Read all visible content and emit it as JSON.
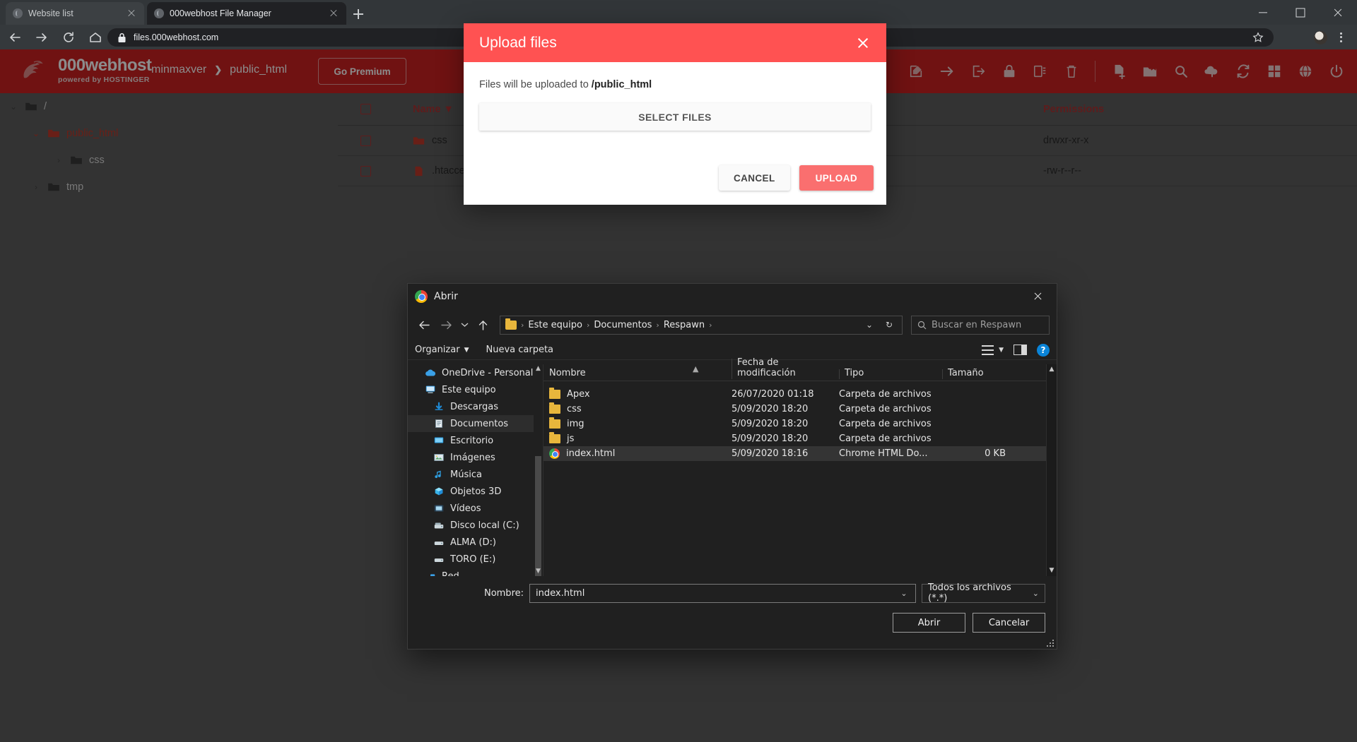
{
  "browser": {
    "tabs": [
      {
        "title": "Website list",
        "active": false
      },
      {
        "title": "000webhost File Manager",
        "active": true
      }
    ],
    "new_tab_label": "+",
    "url": "files.000webhost.com",
    "window_controls": {
      "minimize": "minimize-icon",
      "maximize": "maximize-icon",
      "close": "close-icon"
    }
  },
  "site": {
    "logo_name": "000webhost",
    "logo_sub": "powered by HOSTINGER",
    "breadcrumb": {
      "account": "minmaxver",
      "separator": "❯",
      "folder": "public_html"
    },
    "go_premium": "Go Premium",
    "toolbar_icons": [
      "edit-icon",
      "move-icon",
      "extract-icon",
      "permissions-icon",
      "copy-icon",
      "delete-icon",
      "new-file-icon",
      "new-folder-icon",
      "search-icon",
      "upload-icon",
      "refresh-icon",
      "apps-icon",
      "globe-icon",
      "power-icon"
    ]
  },
  "tree": [
    {
      "label": "/",
      "caret": "⌄",
      "indent": 0,
      "highlight": false
    },
    {
      "label": "public_html",
      "caret": "⌄",
      "indent": 1,
      "highlight": true
    },
    {
      "label": "css",
      "caret": "›",
      "indent": 2,
      "highlight": false
    },
    {
      "label": "tmp",
      "caret": "›",
      "indent": 1,
      "highlight": false
    }
  ],
  "table": {
    "headers": {
      "name": "Name ▼",
      "permissions": "Permissions"
    },
    "rows": [
      {
        "name": "css",
        "type": "folder",
        "permissions": "drwxr-xr-x"
      },
      {
        "name": ".htaccess",
        "type": "file",
        "permissions": "-rw-r--r--"
      }
    ]
  },
  "upload_modal": {
    "title": "Upload files",
    "destination_prefix": "Files will be uploaded to ",
    "destination_path": "/public_html",
    "select_files": "SELECT FILES",
    "cancel": "CANCEL",
    "upload": "UPLOAD",
    "close_icon": "close-icon"
  },
  "file_dialog": {
    "title": "Abrir",
    "breadcrumbs": [
      "Este equipo",
      "Documentos",
      "Respawn"
    ],
    "search_placeholder": "Buscar en Respawn",
    "commands": {
      "organize": "Organizar",
      "new_folder": "Nueva carpeta"
    },
    "columns": [
      "Nombre",
      "Fecha de modificación",
      "Tipo",
      "Tamaño"
    ],
    "sidebar": [
      {
        "label": "OneDrive - Personal",
        "icon": "cloud-icon",
        "indent": 0,
        "selected": false
      },
      {
        "label": "Este equipo",
        "icon": "computer-icon",
        "indent": 0,
        "selected": false
      },
      {
        "label": "Descargas",
        "icon": "download-icon",
        "indent": 1,
        "selected": false
      },
      {
        "label": "Documentos",
        "icon": "documents-icon",
        "indent": 1,
        "selected": true
      },
      {
        "label": "Escritorio",
        "icon": "desktop-icon",
        "indent": 1,
        "selected": false
      },
      {
        "label": "Imágenes",
        "icon": "pictures-icon",
        "indent": 1,
        "selected": false
      },
      {
        "label": "Música",
        "icon": "music-icon",
        "indent": 1,
        "selected": false
      },
      {
        "label": "Objetos 3D",
        "icon": "objects3d-icon",
        "indent": 1,
        "selected": false
      },
      {
        "label": "Vídeos",
        "icon": "videos-icon",
        "indent": 1,
        "selected": false
      },
      {
        "label": "Disco local (C:)",
        "icon": "harddrive-icon",
        "indent": 1,
        "selected": false
      },
      {
        "label": "ALMA (D:)",
        "icon": "drive-icon",
        "indent": 1,
        "selected": false
      },
      {
        "label": "TORO (E:)",
        "icon": "drive-icon",
        "indent": 1,
        "selected": false
      },
      {
        "label": "Red",
        "icon": "network-icon",
        "indent": 0,
        "selected": false
      }
    ],
    "files": [
      {
        "name": "Apex",
        "icon": "folder-icon",
        "date": "26/07/2020 01:18",
        "type": "Carpeta de archivos",
        "size": "",
        "selected": false
      },
      {
        "name": "css",
        "icon": "folder-icon",
        "date": "5/09/2020 18:20",
        "type": "Carpeta de archivos",
        "size": "",
        "selected": false
      },
      {
        "name": "img",
        "icon": "folder-icon",
        "date": "5/09/2020 18:20",
        "type": "Carpeta de archivos",
        "size": "",
        "selected": false
      },
      {
        "name": "js",
        "icon": "folder-icon",
        "date": "5/09/2020 18:20",
        "type": "Carpeta de archivos",
        "size": "",
        "selected": false
      },
      {
        "name": "index.html",
        "icon": "chrome-file-icon",
        "date": "5/09/2020 18:16",
        "type": "Chrome HTML Do...",
        "size": "0 KB",
        "selected": true
      }
    ],
    "name_label": "Nombre:",
    "name_value": "index.html",
    "filter_value": "Todos los archivos (*.*)",
    "open_button": "Abrir",
    "cancel_button": "Cancelar"
  },
  "colors": {
    "brand_red": "#cc2222",
    "modal_red": "#ff5252",
    "upload_btn": "#fa6f6f",
    "chrome_dark": "#323639",
    "windows_dark": "#202020"
  }
}
